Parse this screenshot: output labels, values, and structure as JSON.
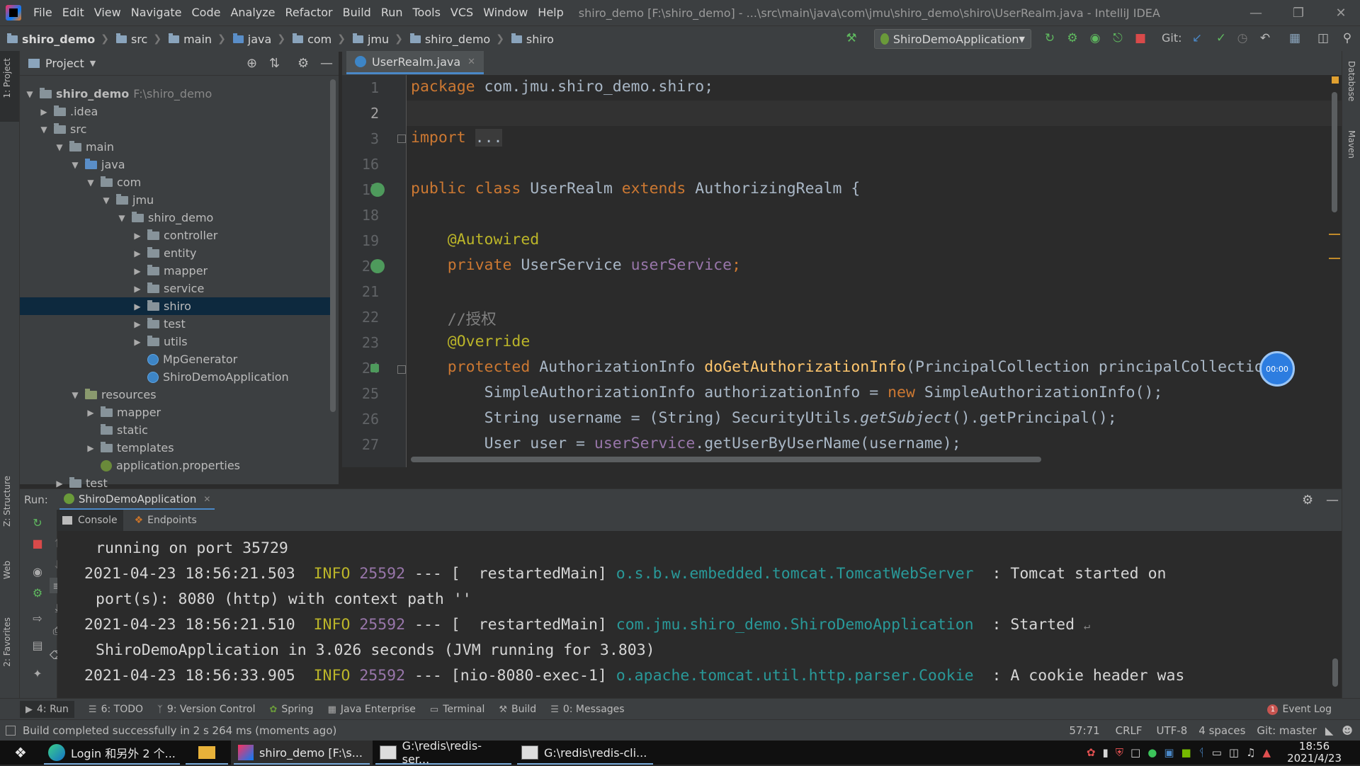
{
  "app": {
    "menu": [
      "File",
      "Edit",
      "View",
      "Navigate",
      "Code",
      "Analyze",
      "Refactor",
      "Build",
      "Run",
      "Tools",
      "VCS",
      "Window",
      "Help"
    ],
    "window_title": "shiro_demo [F:\\shiro_demo] - ...\\src\\main\\java\\com\\jmu\\shiro_demo\\shiro\\UserRealm.java - IntelliJ IDEA"
  },
  "navbar": {
    "breadcrumbs": [
      "shiro_demo",
      "src",
      "main",
      "java",
      "com",
      "jmu",
      "shiro_demo",
      "shiro"
    ],
    "run_config": "ShiroDemoApplication",
    "git_label": "Git:"
  },
  "left_strip": {
    "project_tab": "1: Project",
    "structure_tab": "Z: Structure",
    "web_tab": "Web",
    "favorites_tab": "2: Favorites"
  },
  "right_strip": {
    "database_tab": "Database",
    "maven_tab": "Maven"
  },
  "project": {
    "title": "Project",
    "root_name": "shiro_demo",
    "root_path": "F:\\shiro_demo",
    "items": [
      ".idea",
      "src",
      "main",
      "java",
      "com",
      "jmu",
      "shiro_demo",
      "controller",
      "entity",
      "mapper",
      "service",
      "shiro",
      "test",
      "utils",
      "MpGenerator",
      "ShiroDemoApplication",
      "resources",
      "mapper",
      "static",
      "templates",
      "application.properties",
      "test"
    ]
  },
  "editor": {
    "tab": "UserRealm.java",
    "line_numbers": [
      "1",
      "2",
      "3",
      "16",
      "17",
      "18",
      "19",
      "20",
      "21",
      "22",
      "23",
      "24",
      "25",
      "26",
      "27"
    ],
    "code": {
      "l1_kw": "package",
      "l1_rest": " com.jmu.shiro_demo.shiro;",
      "l3_kw": "import",
      "l3_fold": "...",
      "l17_kw1": "public class",
      "l17_name": " UserRealm ",
      "l17_kw2": "extends",
      "l17_rest": " AuthorizingRealm {",
      "l19_an": "@Autowired",
      "l20_kw": "private",
      "l20_type": " UserService ",
      "l20_field": "userService",
      "l20_end": ";",
      "l22_cm": "//授权",
      "l23_an": "@Override",
      "l24_kw": "protected",
      "l24_type": " AuthorizationInfo ",
      "l24_fn": "doGetAuthorizationInfo",
      "l24_rest": "(PrincipalCollection principalCollection",
      "l25_a": "SimpleAuthorizationInfo authorizationInfo = ",
      "l25_kw": "new",
      "l25_b": " SimpleAuthorizationInfo();",
      "l26_a": "String username = (String) SecurityUtils.",
      "l26_it": "getSubject",
      "l26_b": "().getPrincipal();",
      "l27_a": "User user = ",
      "l27_field": "userService",
      "l27_b": ".getUserByUserName(username);"
    },
    "timer": "00:00"
  },
  "run": {
    "label": "Run:",
    "tab": "ShiroDemoApplication",
    "console_tab": "Console",
    "endpoints_tab": "Endpoints",
    "console": {
      "c1": "running on port 35729",
      "c2_ts": "2021-04-23 18:56:21.503",
      "c2_lvl": "INFO",
      "c2_pid": "25592",
      "c2_thr": " --- [  restartedMain] ",
      "c2_log": "o.s.b.w.embedded.tomcat.TomcatWebServer",
      "c2_msg": "  : Tomcat started on",
      "c3": "port(s): 8080 (http) with context path ''",
      "c4_ts": "2021-04-23 18:56:21.510",
      "c4_lvl": "INFO",
      "c4_pid": "25592",
      "c4_thr": " --- [  restartedMain] ",
      "c4_log": "com.jmu.shiro_demo.ShiroDemoApplication",
      "c4_msg": "  : Started",
      "c5": "ShiroDemoApplication in 3.026 seconds (JVM running for 3.803)",
      "c6_ts": "2021-04-23 18:56:33.905",
      "c6_lvl": "INFO",
      "c6_pid": "25592",
      "c6_thr": " --- [nio-8080-exec-1] ",
      "c6_log": "o.apache.tomcat.util.http.parser.Cookie",
      "c6_msg": "  : A cookie header was"
    }
  },
  "tool_tabs": [
    "4: Run",
    "6: TODO",
    "9: Version Control",
    "Spring",
    "Java Enterprise",
    "Terminal",
    "Build",
    "0: Messages"
  ],
  "event_log": "Event Log",
  "event_count": "1",
  "status": {
    "message": "Build completed successfully in 2 s 264 ms (moments ago)",
    "position": "57:71",
    "line_sep": "CRLF",
    "encoding": "UTF-8",
    "indent": "4 spaces",
    "git": "Git: master"
  },
  "taskbar": {
    "items": [
      "Login 和另外 2 个...",
      "shiro_demo [F:\\s...",
      "G:\\redis\\redis-ser...",
      "G:\\redis\\redis-cli..."
    ],
    "time": "18:56",
    "date": "2021/4/23"
  }
}
